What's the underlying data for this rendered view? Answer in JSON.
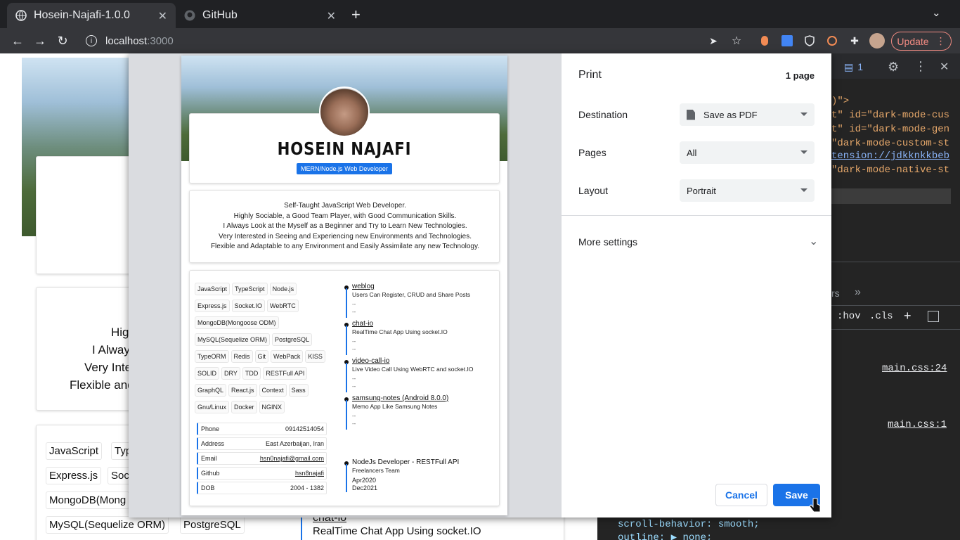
{
  "browser": {
    "tabs": [
      {
        "title": "Hosein-Najafi-1.0.0",
        "active": true
      },
      {
        "title": "GitHub",
        "active": false
      }
    ],
    "url_host": "localhost",
    "url_port": ":3000",
    "update_label": "Update"
  },
  "devtools": {
    "issues_count": "1",
    "code_lines": [
      ")\">",
      "t\" id=\"dark-mode-cus",
      "t\" id=\"dark-mode-gen",
      "\"dark-mode-custom-st",
      "tension://jdkknkkbeb",
      "\"dark-mode-native-st"
    ],
    "tab_more": "rs",
    "hov": ":hov",
    "cls": ".cls",
    "css_links": [
      "main.css:24",
      "main.css:1"
    ],
    "bottom_code": [
      "scroll-behavior: smooth;",
      "outline: ▶ none;"
    ]
  },
  "print": {
    "title": "Print",
    "pages_count": "1 page",
    "destination_label": "Destination",
    "destination_value": "Save as PDF",
    "pages_label": "Pages",
    "pages_value": "All",
    "layout_label": "Layout",
    "layout_value": "Portrait",
    "more_settings": "More settings",
    "cancel": "Cancel",
    "save": "Save"
  },
  "resume": {
    "name": "HOSEIN NAJAFI",
    "role": "MERN/Node.js Web Developer",
    "about": [
      "Self-Taught JavaScript Web Developer.",
      "Highly Sociable, a Good Team Player, with Good Communication Skills.",
      "I Always Look at the Myself as a Beginner and Try to Learn New Technologies.",
      "Very Interested in Seeing and Experiencing new Environments and Technologies.",
      "Flexible and Adaptable to any Environment and Easily Assimilate any new Technology."
    ],
    "skills": [
      [
        "JavaScript",
        "TypeScript",
        "Node.js"
      ],
      [
        "Express.js",
        "Socket.IO",
        "WebRTC"
      ],
      [
        "MongoDB(Mongoose ODM)"
      ],
      [
        "MySQL(Sequelize ORM)",
        "PostgreSQL"
      ],
      [
        "TypeORM",
        "Redis",
        "Git",
        "WebPack",
        "KISS"
      ],
      [
        "SOLID",
        "DRY",
        "TDD",
        "RESTFull API"
      ],
      [
        "GraphQL",
        "React.js",
        "Context",
        "Sass"
      ],
      [
        "Gnu/Linux",
        "Docker",
        "NGINX"
      ]
    ],
    "info": [
      {
        "label": "Phone",
        "value": "09142514054"
      },
      {
        "label": "Address",
        "value": "East Azerbaijan, Iran"
      },
      {
        "label": "Email",
        "value": "hsn0najafi@gmail.com"
      },
      {
        "label": "Github",
        "value": "hsn8najafi"
      },
      {
        "label": "DOB",
        "value": "2004 - 1382"
      }
    ],
    "projects": [
      {
        "title": "weblog",
        "desc": "Users Can Register, CRUD and Share Posts"
      },
      {
        "title": "chat-io",
        "desc": "RealTime Chat App Using socket.IO"
      },
      {
        "title": "video-call-io",
        "desc": "Live Video Call Using WebRTC and socket.IO"
      },
      {
        "title": "samsung-notes (Android 8.0.0)",
        "desc": "Memo App Like Samsung Notes"
      }
    ],
    "dash": "--",
    "experience": {
      "title": "NodeJs Developer - RESTFull API",
      "company": "Freelancers Team",
      "start": "Apr2020",
      "end": "Dec2021"
    }
  },
  "background_page": {
    "about_fragments": [
      "Hig",
      "I Alway",
      "Very Inte",
      "Flexible and"
    ],
    "chips": [
      "JavaScript",
      "Typ",
      "Express.js",
      "Soc",
      "MongoDB(Mong",
      "MySQL(Sequelize ORM)",
      "PostgreSQL"
    ],
    "project_title": "chat-io",
    "project_desc": "RealTime Chat App Using socket.IO"
  }
}
